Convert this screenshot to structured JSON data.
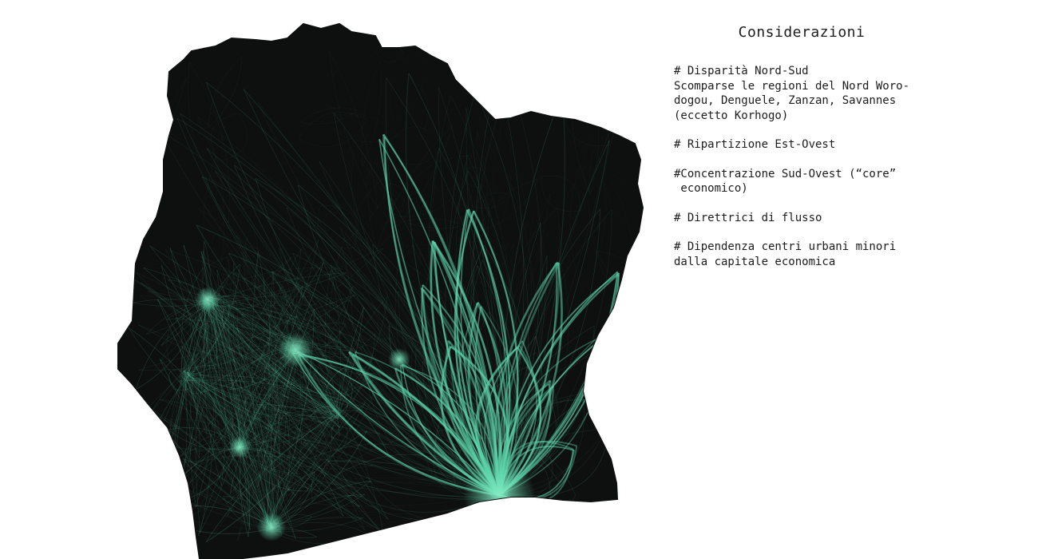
{
  "panel": {
    "title": "Considerazioni",
    "notes": [
      {
        "heading": "# Disparità Nord-Sud",
        "lines": [
          "Scomparse le regioni del Nord Woro-",
          "dogou, Denguele, Zanzan, Savannes",
          "(eccetto Korhogo)"
        ]
      },
      {
        "heading": "# Ripartizione Est-Ovest",
        "lines": []
      },
      {
        "heading": "#Concentrazione Sud-Ovest (“core”",
        "lines": [
          " economico)"
        ]
      },
      {
        "heading": "# Direttrici di flusso",
        "lines": []
      },
      {
        "heading": "# Dipendenza centri urbani minori",
        "lines": [
          "dalla capitale economica"
        ]
      }
    ]
  },
  "map": {
    "land_color": "#0e0f0f",
    "flow_color": "#5fd6ad",
    "background_color": "#ffffff"
  }
}
